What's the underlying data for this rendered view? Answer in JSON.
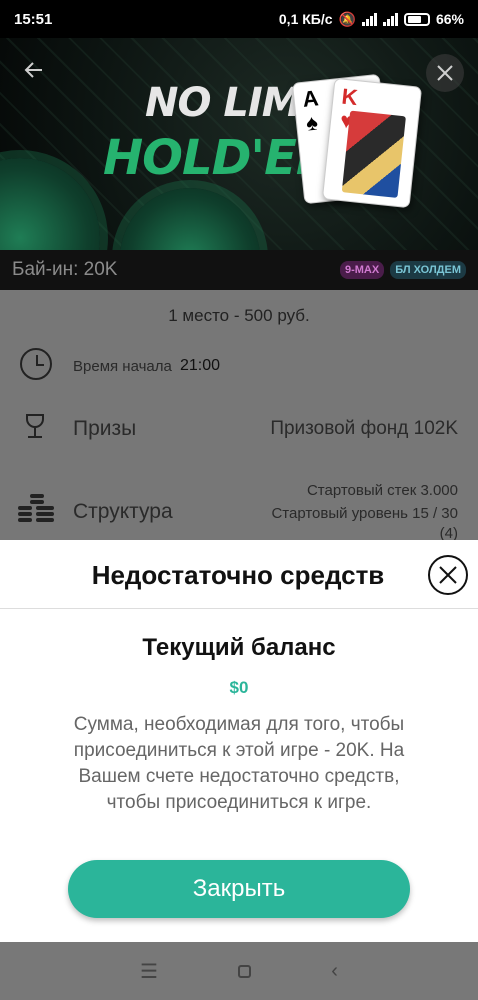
{
  "status_bar": {
    "time": "15:51",
    "network_speed": "0,1 КБ/с",
    "battery": "66%"
  },
  "banner": {
    "title_line1": "NO LIMIT",
    "title_line2": "HOLD'EM",
    "card1_rank": "A",
    "card1_suit": "♠",
    "card2_rank": "K",
    "card2_suit": "♥"
  },
  "buyin": {
    "label": "Бай-ин: 20K",
    "badge_max": "9-MAX",
    "badge_game": "БЛ ХОЛДЕМ"
  },
  "details": {
    "first_place": "1 место - 500 руб.",
    "start_time_label": "Время начала",
    "start_time_value": "21:00",
    "prizes_label": "Призы",
    "prize_pool": "Призовой фонд 102K",
    "structure_label": "Структура",
    "starting_stack": "Стартовый стек 3.000",
    "starting_level": "Стартовый уровень 15 / 30",
    "level_extra": "(4)"
  },
  "modal": {
    "title": "Недостаточно средств",
    "balance_title": "Текущий баланс",
    "balance_value": "$0",
    "message": "Сумма, необходимая для того, чтобы присоединиться к этой игре - 20K. На Вашем счете недостаточно средств, чтобы присоединиться к игре.",
    "close_button": "Закрыть"
  },
  "colors": {
    "accent": "#2bb59a",
    "title_green": "#26b36f"
  },
  "icons": [
    "back-arrow-icon",
    "close-icon",
    "clock-icon",
    "trophy-icon",
    "chips-stack-icon",
    "menu-icon",
    "home-icon",
    "back-icon"
  ]
}
